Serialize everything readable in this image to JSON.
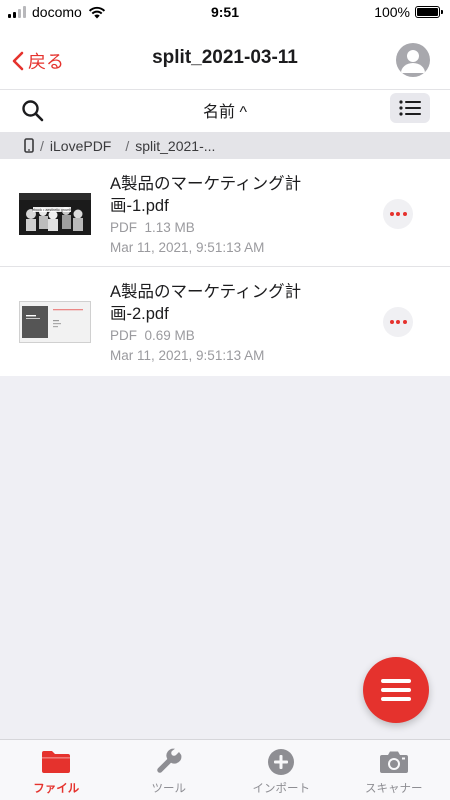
{
  "status_bar": {
    "carrier": "docomo",
    "time": "9:51",
    "battery": "100%",
    "battery_level": 1.0
  },
  "nav": {
    "back_label": "戻る",
    "title": "split_2021-03-11"
  },
  "toolbar": {
    "sort_label": "名前 ^"
  },
  "breadcrumb": {
    "items": [
      "iLovePDF",
      "split_2021-..."
    ],
    "separator": "/"
  },
  "files": [
    {
      "name_line1": "A製品のマーケティング計",
      "name_line2": "画-1.pdf",
      "type": "PDF",
      "size": "1.13 MB",
      "date": "Mar 11, 2021, 9:51:13 AM",
      "thumb_caption": "ebook • aesthetic growth"
    },
    {
      "name_line1": "A製品のマーケティング計",
      "name_line2": "画-2.pdf",
      "type": "PDF",
      "size": "0.69 MB",
      "date": "Mar 11, 2021, 9:51:13 AM"
    }
  ],
  "tabs": [
    {
      "label": "ファイル",
      "icon": "folder-icon",
      "active": true
    },
    {
      "label": "ツール",
      "icon": "wrench-icon",
      "active": false
    },
    {
      "label": "インポート",
      "icon": "plus-circle-icon",
      "active": false
    },
    {
      "label": "スキャナー",
      "icon": "camera-icon",
      "active": false
    }
  ],
  "colors": {
    "accent": "#e5322d",
    "background": "#efeff4",
    "breadcrumb_bg": "#e4e4e8",
    "inactive_tab": "#8e8e93"
  }
}
